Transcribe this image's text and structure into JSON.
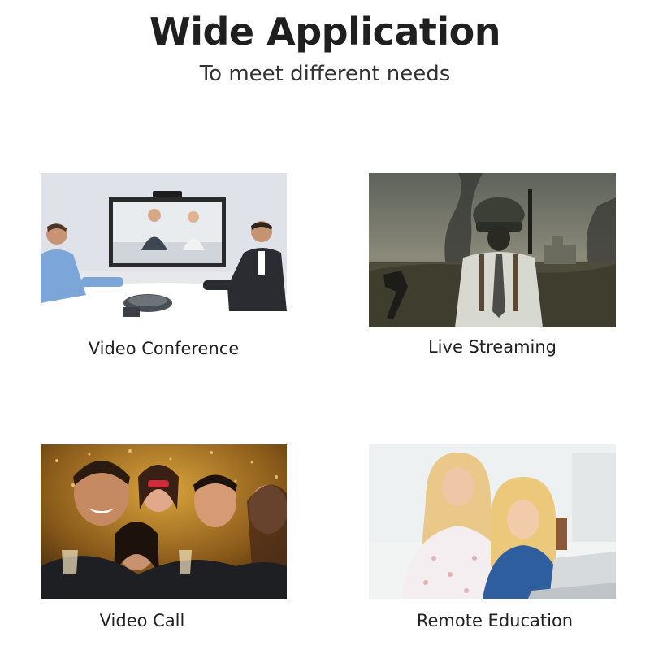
{
  "header": {
    "title": "Wide Application",
    "subtitle": "To meet different needs"
  },
  "applications": [
    {
      "label": "Video Conference"
    },
    {
      "label": "Live Streaming"
    },
    {
      "label": "Video Call"
    },
    {
      "label": "Remote Education"
    }
  ]
}
